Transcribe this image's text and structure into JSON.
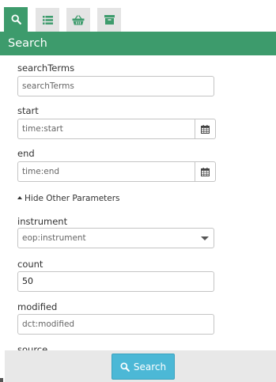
{
  "tabs": [
    {
      "icon": "search-icon",
      "active": true
    },
    {
      "icon": "list-icon",
      "active": false
    },
    {
      "icon": "basket-icon",
      "active": false
    },
    {
      "icon": "archive-icon",
      "active": false
    }
  ],
  "header": {
    "title": "Search"
  },
  "form": {
    "searchTerms": {
      "label": "searchTerms",
      "placeholder": "searchTerms"
    },
    "start": {
      "label": "start",
      "placeholder": "time:start"
    },
    "end": {
      "label": "end",
      "placeholder": "time:end"
    },
    "toggle_label": "Hide Other Parameters",
    "instrument": {
      "label": "instrument",
      "value": "eop:instrument"
    },
    "count": {
      "label": "count",
      "value": "50"
    },
    "modified": {
      "label": "modified",
      "placeholder": "dct:modified"
    },
    "source": {
      "label": "source"
    }
  },
  "footer": {
    "search_label": "Search"
  },
  "colors": {
    "accent": "#3d9b6c",
    "button": "#4cb8d6"
  }
}
